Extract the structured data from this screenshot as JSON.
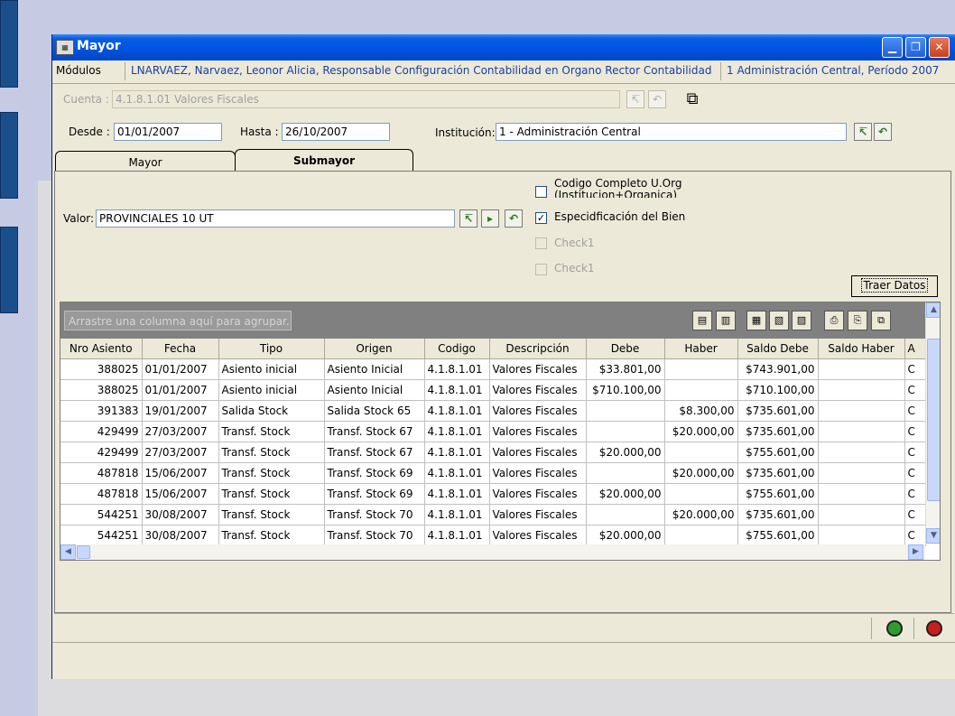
{
  "window": {
    "title": "Mayor",
    "icon": "window-app-icon"
  },
  "modbar": {
    "modules_label": "Módulos",
    "user": "LNARVAEZ, Narvaez, Leonor Alicia, Responsable Configuración Contabilidad en Organo Rector Contabilidad",
    "entity": "1 Administración Central, Período 2007"
  },
  "cuenta": {
    "label": "Cuenta :",
    "value": "4.1.8.1.01 Valores Fiscales"
  },
  "desde": {
    "label": "Desde :",
    "value": "01/01/2007"
  },
  "hasta": {
    "label": "Hasta :",
    "value": "26/10/2007"
  },
  "institucion": {
    "label": "Institución:",
    "value": "1 - Administración Central"
  },
  "tabs": [
    {
      "label": "Mayor",
      "active": false
    },
    {
      "label": "Submayor",
      "active": true
    }
  ],
  "submayor": {
    "valor_label": "Valor:",
    "valor": "PROVINCIALES 10 UT",
    "checks": [
      {
        "label": "Codigo Completo U.Org (Institucion+Organica)",
        "checked": false,
        "enabled": true
      },
      {
        "label": "Especidficación del Bien",
        "checked": true,
        "enabled": true
      },
      {
        "label": "Check1",
        "checked": false,
        "enabled": false
      },
      {
        "label": "Check1",
        "checked": false,
        "enabled": false
      }
    ],
    "traer_label": "Traer Datos"
  },
  "grid": {
    "group_hint": "Arrastre una columna aquí para agrupar.",
    "columns": [
      "Nro Asiento",
      "Fecha",
      "Tipo",
      "Origen",
      "Codigo",
      "Descripción",
      "Debe",
      "Haber",
      "Saldo Debe",
      "Saldo Haber",
      "A"
    ],
    "rows": [
      [
        "388025",
        "01/01/2007",
        "Asiento inicial",
        "Asiento Inicial",
        "4.1.8.1.01",
        "Valores Fiscales",
        "$33.801,00",
        "",
        "$743.901,00",
        "",
        "C"
      ],
      [
        "388025",
        "01/01/2007",
        "Asiento inicial",
        "Asiento Inicial",
        "4.1.8.1.01",
        "Valores Fiscales",
        "$710.100,00",
        "",
        "$710.100,00",
        "",
        "C"
      ],
      [
        "391383",
        "19/01/2007",
        "Salida Stock",
        "Salida Stock 65",
        "4.1.8.1.01",
        "Valores Fiscales",
        "",
        "$8.300,00",
        "$735.601,00",
        "",
        "C"
      ],
      [
        "429499",
        "27/03/2007",
        "Transf. Stock",
        "Transf. Stock 67",
        "4.1.8.1.01",
        "Valores Fiscales",
        "",
        "$20.000,00",
        "$735.601,00",
        "",
        "C"
      ],
      [
        "429499",
        "27/03/2007",
        "Transf. Stock",
        "Transf. Stock 67",
        "4.1.8.1.01",
        "Valores Fiscales",
        "$20.000,00",
        "",
        "$755.601,00",
        "",
        "C"
      ],
      [
        "487818",
        "15/06/2007",
        "Transf. Stock",
        "Transf. Stock 69",
        "4.1.8.1.01",
        "Valores Fiscales",
        "",
        "$20.000,00",
        "$735.601,00",
        "",
        "C"
      ],
      [
        "487818",
        "15/06/2007",
        "Transf. Stock",
        "Transf. Stock 69",
        "4.1.8.1.01",
        "Valores Fiscales",
        "$20.000,00",
        "",
        "$755.601,00",
        "",
        "C"
      ],
      [
        "544251",
        "30/08/2007",
        "Transf. Stock",
        "Transf. Stock 70",
        "4.1.8.1.01",
        "Valores Fiscales",
        "",
        "$20.000,00",
        "$735.601,00",
        "",
        "C"
      ],
      [
        "544251",
        "30/08/2007",
        "Transf. Stock",
        "Transf. Stock 70",
        "4.1.8.1.01",
        "Valores Fiscales",
        "$20.000,00",
        "",
        "$755.601,00",
        "",
        "C"
      ]
    ]
  },
  "status": {
    "ok_color": "#2e9d2e",
    "stop_color": "#c81e1e"
  },
  "colors": {
    "titlebar": "#0054e3",
    "window_bg": "#ece9d8",
    "desktop": "#c6cae3",
    "slide_tab": "#1a4f8c"
  }
}
